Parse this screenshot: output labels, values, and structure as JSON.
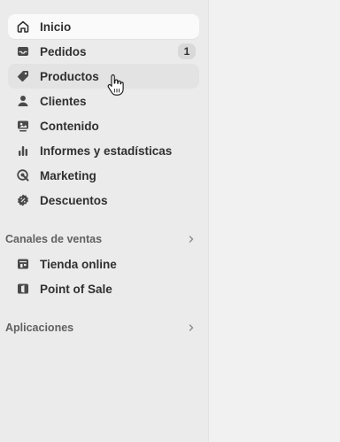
{
  "nav": {
    "items": [
      {
        "label": "Inicio",
        "icon": "home-icon"
      },
      {
        "label": "Pedidos",
        "icon": "inbox-icon",
        "badge": "1"
      },
      {
        "label": "Productos",
        "icon": "tag-icon"
      },
      {
        "label": "Clientes",
        "icon": "person-icon"
      },
      {
        "label": "Contenido",
        "icon": "image-icon"
      },
      {
        "label": "Informes y estadísticas",
        "icon": "bar-chart-icon"
      },
      {
        "label": "Marketing",
        "icon": "target-icon"
      },
      {
        "label": "Descuentos",
        "icon": "discount-icon"
      }
    ]
  },
  "sales_channels": {
    "heading": "Canales de ventas",
    "items": [
      {
        "label": "Tienda online",
        "icon": "store-icon"
      },
      {
        "label": "Point of Sale",
        "icon": "pos-icon"
      }
    ]
  },
  "apps": {
    "heading": "Aplicaciones"
  },
  "colors": {
    "sidebar_bg": "#ebebeb",
    "main_bg": "#f1f1f1",
    "active_bg": "#fafafa",
    "text": "#303030",
    "muted": "#616161"
  }
}
